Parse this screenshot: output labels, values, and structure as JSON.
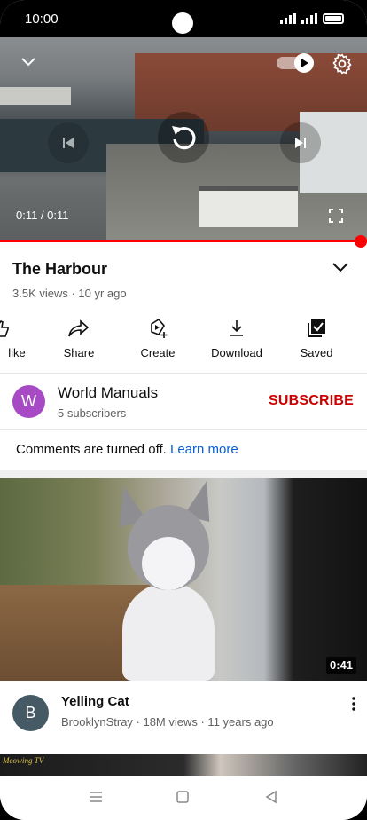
{
  "status_bar": {
    "time": "10:00"
  },
  "player": {
    "timecode": "0:11 / 0:11",
    "progress": 1.0
  },
  "video": {
    "title": "The Harbour",
    "meta": "3.5K views · 10 yr ago"
  },
  "actions": [
    {
      "label": "like",
      "icon": "thumbs-up-icon"
    },
    {
      "label": "Share",
      "icon": "share-icon"
    },
    {
      "label": "Create",
      "icon": "create-icon"
    },
    {
      "label": "Download",
      "icon": "download-icon"
    },
    {
      "label": "Saved",
      "icon": "saved-icon"
    }
  ],
  "channel": {
    "avatar_letter": "W",
    "name": "World Manuals",
    "subscribers": "5 subscribers",
    "subscribe_label": "SUBSCRIBE",
    "avatar_color": "#a64bc4",
    "subscribe_color": "#cc0000"
  },
  "comments": {
    "text": "Comments are turned off.",
    "link": "Learn more"
  },
  "recommended": {
    "duration": "0:41",
    "avatar_letter": "B",
    "title": "Yelling Cat",
    "meta": "BrooklynStray · 18M views · 11 years ago"
  },
  "next_thumb": {
    "brand": "Meowing TV"
  },
  "colors": {
    "accent": "#ff0000",
    "link": "#065fd4"
  }
}
